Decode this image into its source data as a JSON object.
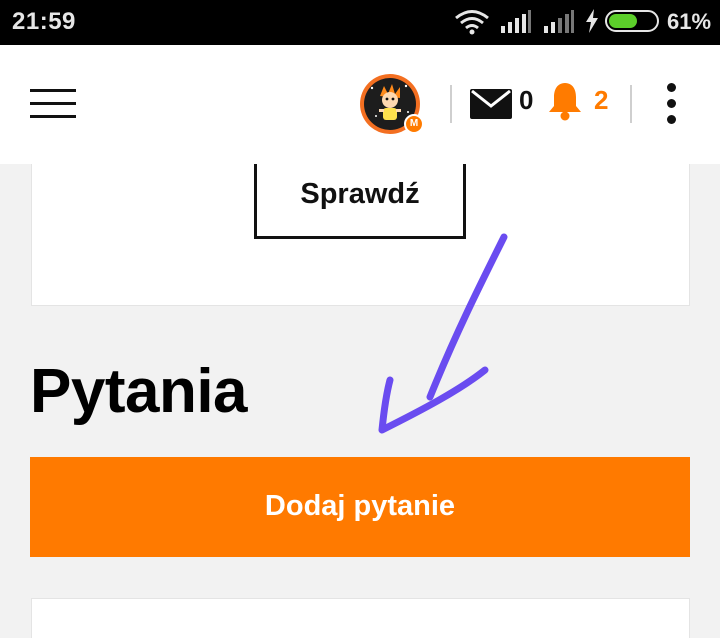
{
  "status_bar": {
    "time": "21:59",
    "battery_percent": "61%",
    "battery_level": 0.61
  },
  "header": {
    "avatar_badge": "M",
    "messages_count": "0",
    "notifications_count": "2"
  },
  "content": {
    "check_button_label": "Sprawdź",
    "section_title": "Pytania",
    "add_question_label": "Dodaj pytanie"
  },
  "colors": {
    "accent": "#ff7a00",
    "annotation_arrow": "#6a4cf0"
  }
}
